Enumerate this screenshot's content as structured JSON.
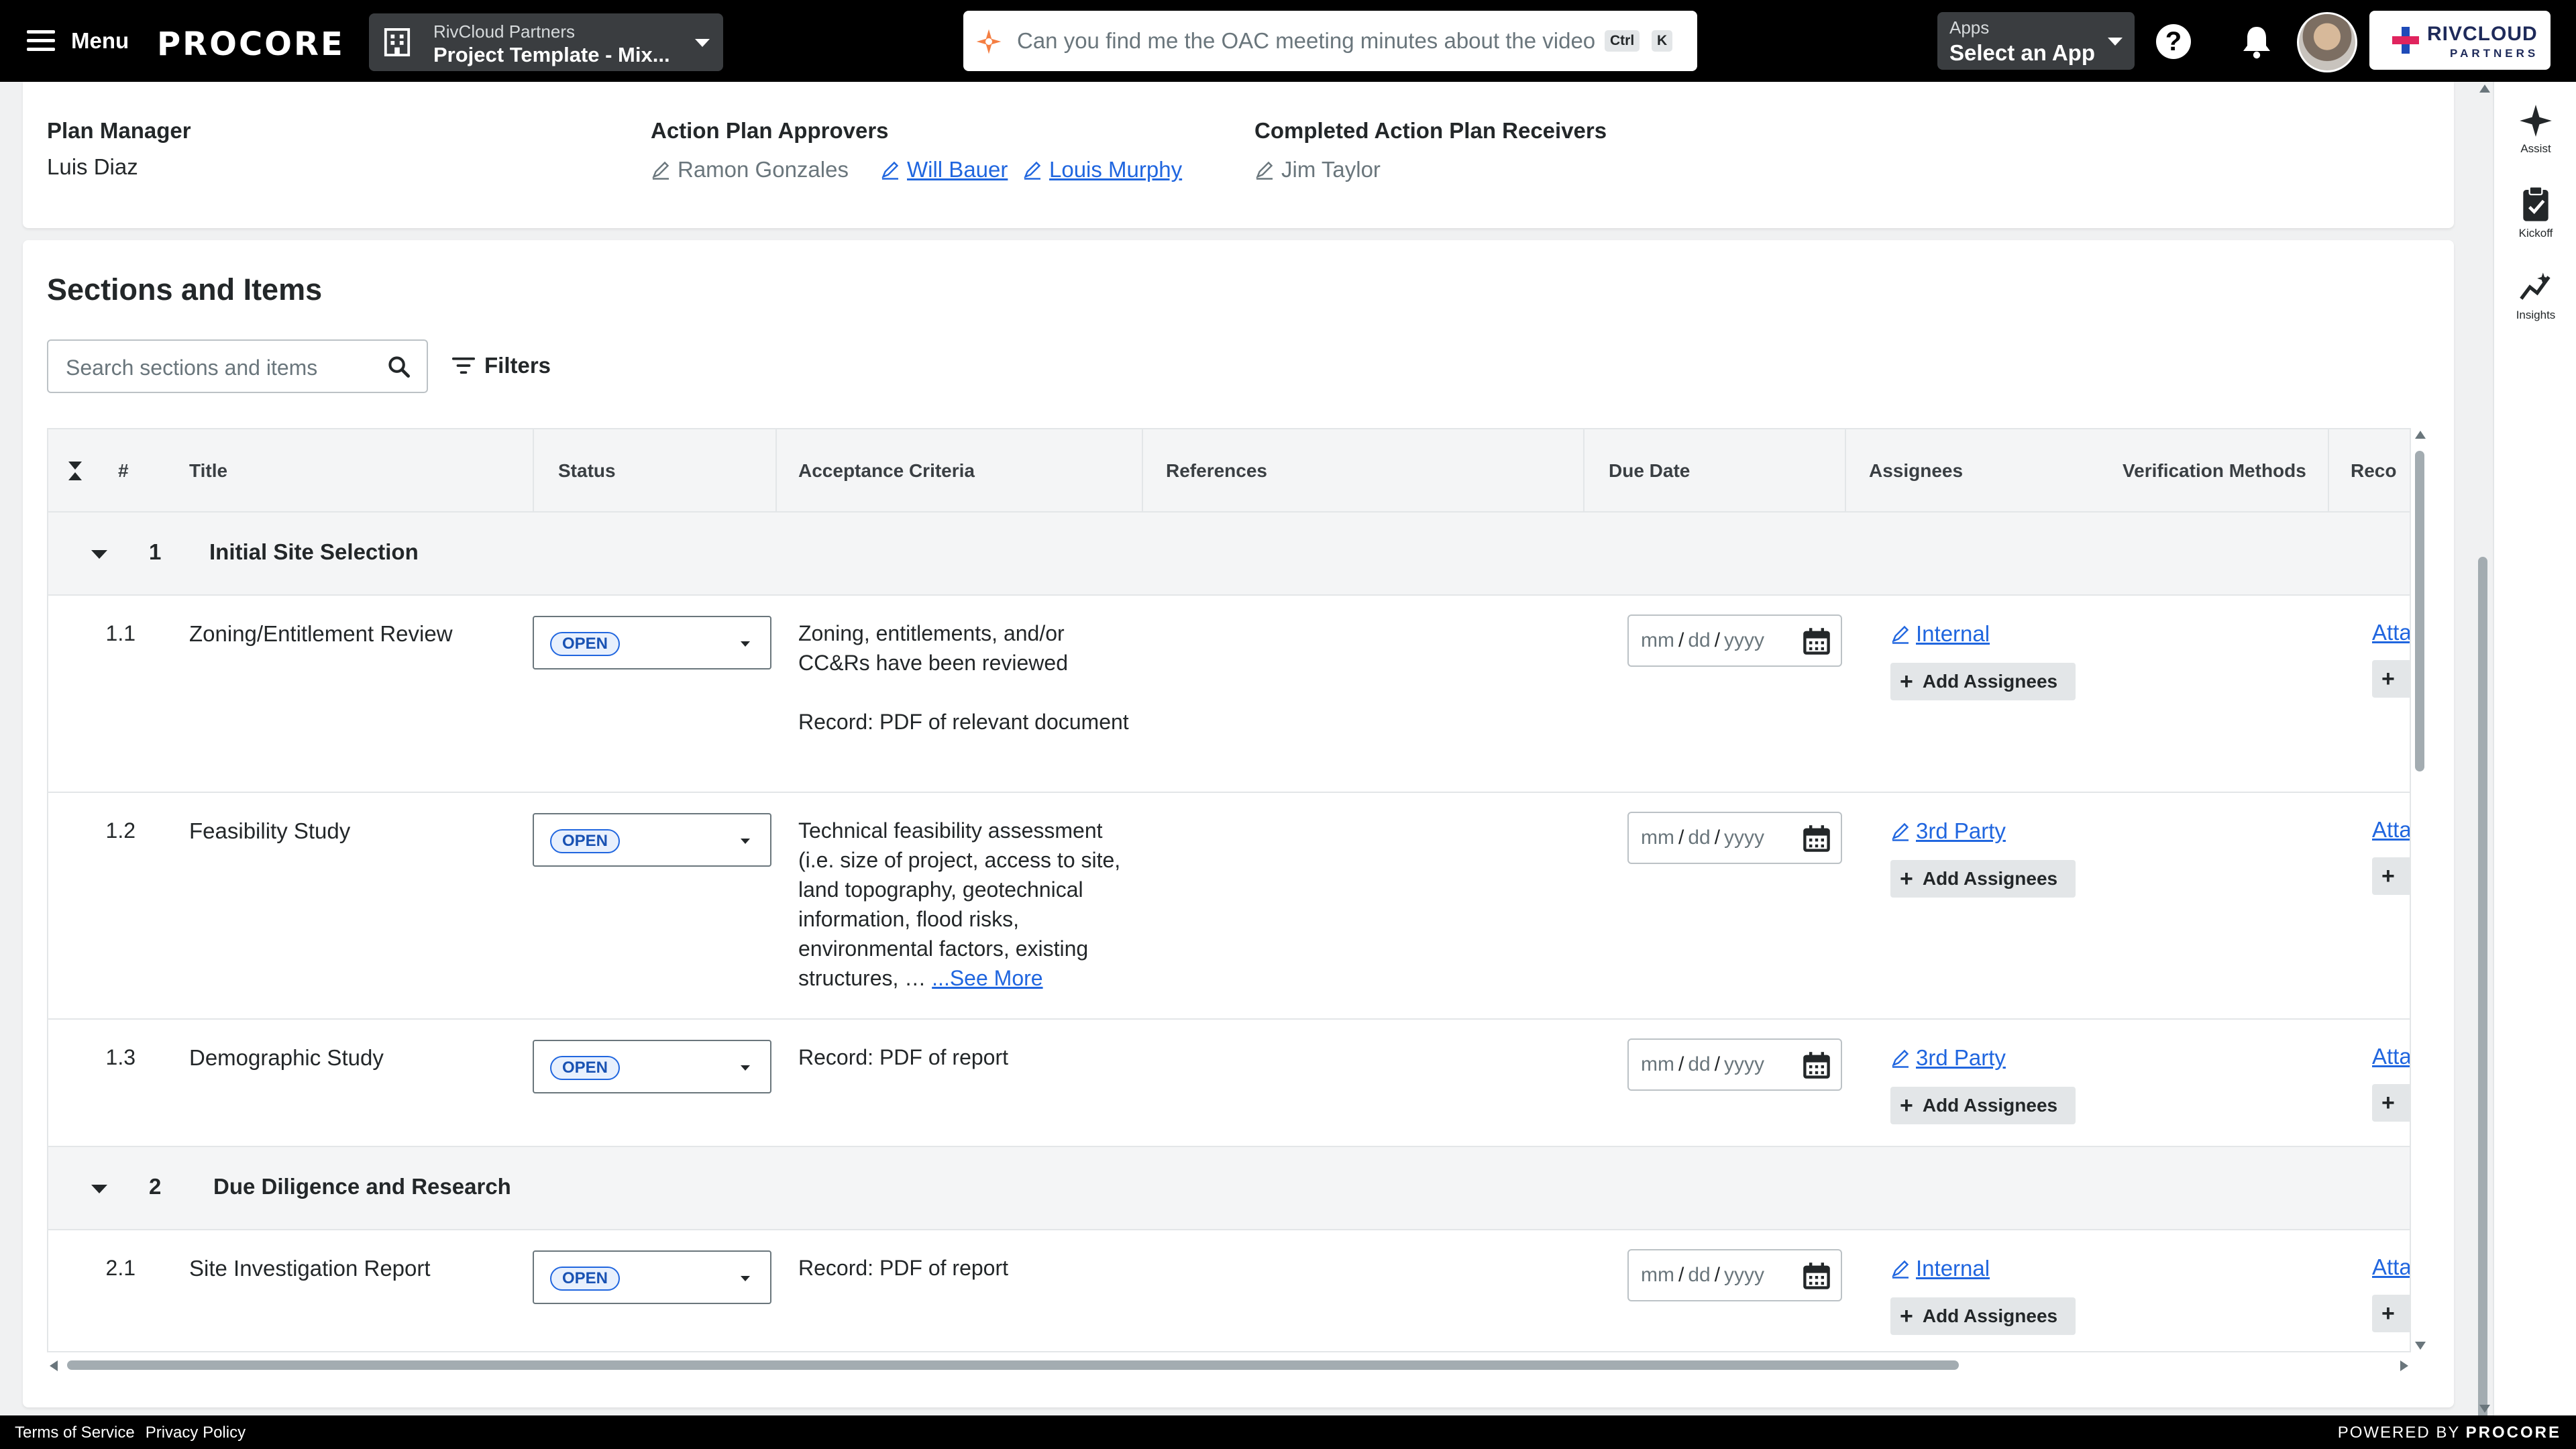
{
  "topnav": {
    "menu_label": "Menu",
    "logo_text": "PROCORE",
    "project_picker": {
      "company": "RivCloud Partners",
      "project": "Project Template - Mix..."
    },
    "assist_prompt": "Can you find me the OAC meeting minutes about the video",
    "shortcut_keys": [
      "Ctrl",
      "K"
    ],
    "apps_picker": {
      "label": "Apps",
      "value": "Select an App"
    },
    "partner_logo": {
      "name": "RIVCLOUD",
      "sub": "PARTNERS"
    }
  },
  "right_rail": [
    {
      "label": "Assist",
      "icon": "sparkle-icon"
    },
    {
      "label": "Kickoff",
      "icon": "clipboard-check-icon"
    },
    {
      "label": "Insights",
      "icon": "insights-icon"
    }
  ],
  "plan": {
    "manager_label": "Plan Manager",
    "manager": "Luis Diaz",
    "approvers_label": "Action Plan Approvers",
    "approvers": [
      {
        "name": "Ramon Gonzales",
        "linked": false
      },
      {
        "name": "Will Bauer",
        "linked": true
      },
      {
        "name": "Louis Murphy",
        "linked": true
      }
    ],
    "receivers_label": "Completed Action Plan Receivers",
    "receivers": [
      {
        "name": "Jim Taylor",
        "linked": false
      }
    ]
  },
  "sections": {
    "title": "Sections and Items",
    "search_placeholder": "Search sections and items",
    "filters_label": "Filters",
    "columns": {
      "num": "#",
      "title": "Title",
      "status": "Status",
      "criteria": "Acceptance Criteria",
      "references": "References",
      "due_date": "Due Date",
      "assignees": "Assignees",
      "verification": "Verification Methods",
      "records": "Reco"
    },
    "date_placeholder": {
      "mm": "mm",
      "dd": "dd",
      "yyyy": "yyyy",
      "sep": "/"
    },
    "add_assignees_label": "Add Assignees",
    "attach_label": "Atta",
    "attach_add": "+",
    "groups": [
      {
        "number": "1",
        "title": "Initial Site Selection",
        "items": [
          {
            "number": "1.1",
            "title": "Zoning/Entitlement Review",
            "status": "OPEN",
            "criteria": "Zoning, entitlements, and/or CC&Rs have been reviewed",
            "criteria_extra": "Record: PDF of relevant document",
            "assignee": "Internal"
          },
          {
            "number": "1.2",
            "title": "Feasibility Study",
            "status": "OPEN",
            "criteria": "Technical feasibility assessment (i.e. size of project, access to site, land topography, geotechnical information, flood risks, environmental factors, existing structures, …",
            "see_more": "...See More",
            "assignee": "3rd Party"
          },
          {
            "number": "1.3",
            "title": "Demographic Study",
            "status": "OPEN",
            "criteria": "Record: PDF of report",
            "assignee": "3rd Party"
          }
        ]
      },
      {
        "number": "2",
        "title": "Due Diligence and Research",
        "items": [
          {
            "number": "2.1",
            "title": "Site Investigation Report",
            "status": "OPEN",
            "criteria": "Record: PDF of report",
            "assignee": "Internal"
          }
        ]
      }
    ]
  },
  "footer": {
    "terms": "Terms of Service",
    "privacy": "Privacy Policy",
    "powered_by": "POWERED BY",
    "powered_brand": "PROCORE"
  },
  "colors": {
    "accent": "#2066df",
    "brand_orange": "#f47e42",
    "topbar": "#000000"
  }
}
